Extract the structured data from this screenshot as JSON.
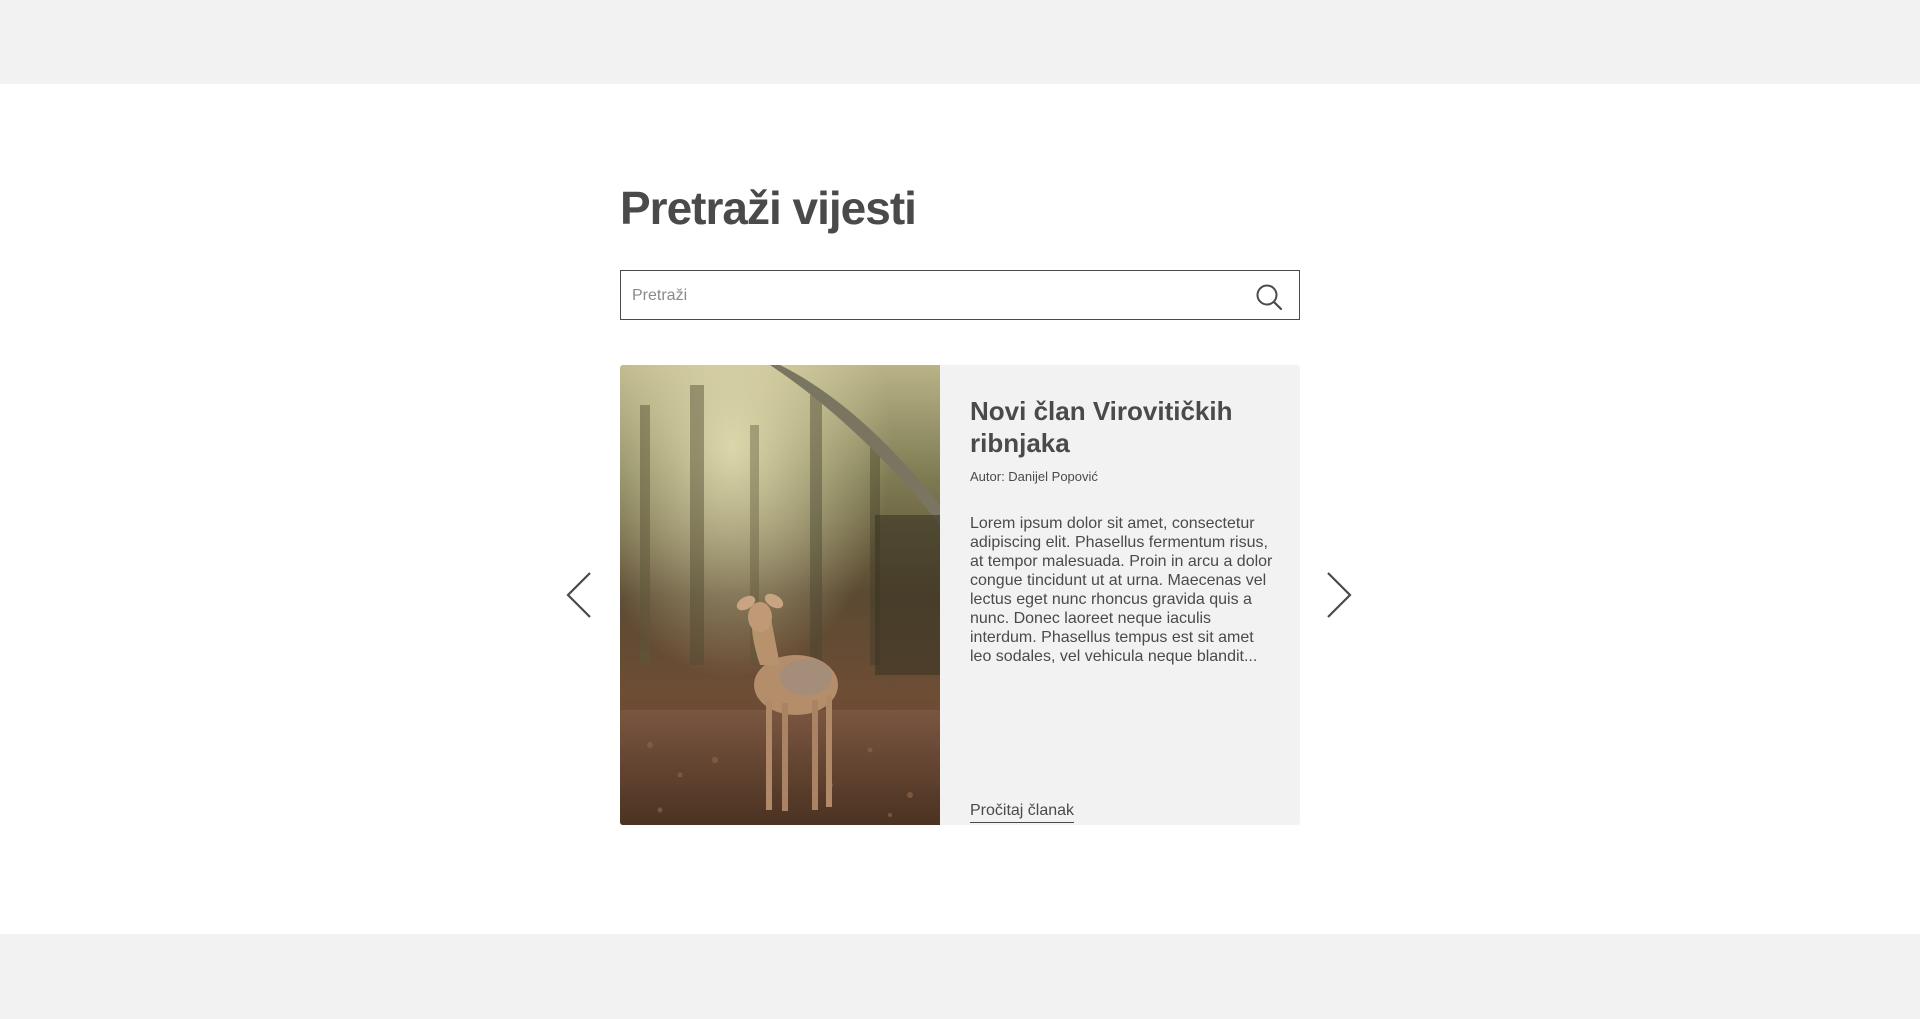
{
  "header": {},
  "main": {
    "title": "Pretraži vijesti",
    "search": {
      "placeholder": "Pretraži",
      "value": "",
      "icon": "search-icon"
    },
    "carousel": {
      "prev_icon": "chevron-left-icon",
      "next_icon": "chevron-right-icon",
      "article": {
        "title": "Novi član Virovitičkih ribnjaka",
        "author": "Autor: Danijel Popović",
        "excerpt": "Lorem ipsum dolor sit amet, consectetur adipiscing elit. Phasellus fermentum risus, at tempor malesuada. Proin in arcu a dolor congue tincidunt ut at urna. Maecenas vel lectus eget nunc rhoncus gravida quis a nunc. Donec laoreet neque iaculis interdum. Phasellus tempus est sit amet leo sodales, vel vehicula neque blandit...",
        "link_label": "Pročitaj članak",
        "image": "fawn-in-forest-photo"
      }
    }
  },
  "colors": {
    "text": "#4a4a4a",
    "band": "#f2f2f2",
    "card_bg": "#f2f2f2",
    "background": "#ffffff"
  }
}
